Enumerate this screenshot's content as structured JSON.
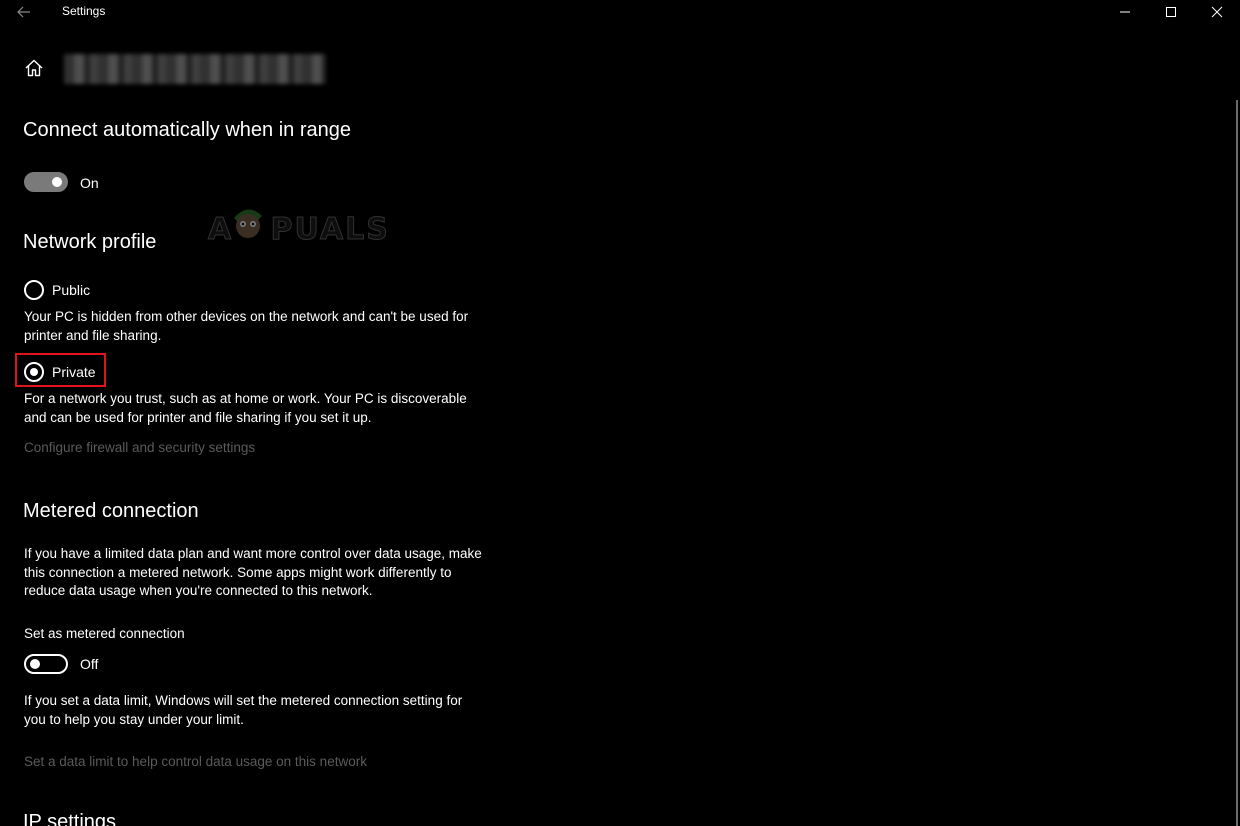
{
  "window": {
    "title": "Settings",
    "back_icon": "back-arrow-icon",
    "minimize_icon": "minimize-icon",
    "maximize_icon": "maximize-icon",
    "close_icon": "close-icon"
  },
  "header": {
    "home_icon": "home-icon",
    "network_name_redacted": true
  },
  "connect_auto": {
    "heading": "Connect automatically when in range",
    "toggle_state": "On",
    "toggle_on": true
  },
  "network_profile": {
    "heading": "Network profile",
    "options": [
      {
        "label": "Public",
        "description": "Your PC is hidden from other devices on the network and can't be used for printer and file sharing.",
        "selected": false
      },
      {
        "label": "Private",
        "description": "For a network you trust, such as at home or work. Your PC is discoverable and can be used for printer and file sharing if you set it up.",
        "selected": true
      }
    ],
    "firewall_link": "Configure firewall and security settings"
  },
  "metered": {
    "heading": "Metered connection",
    "description": "If you have a limited data plan and want more control over data usage, make this connection a metered network. Some apps might work differently to reduce data usage when you're connected to this network.",
    "toggle_label": "Set as metered connection",
    "toggle_state": "Off",
    "toggle_on": false,
    "limit_note": "If you set a data limit, Windows will set the metered connection setting for you to help you stay under your limit.",
    "data_limit_link": "Set a data limit to help control data usage on this network"
  },
  "ip_settings": {
    "heading": "IP settings"
  },
  "watermark": {
    "text": "APPUALS"
  },
  "colors": {
    "background": "#000000",
    "text": "#ffffff",
    "disabled_link": "#5a5a5a",
    "highlight": "#e0141b"
  }
}
